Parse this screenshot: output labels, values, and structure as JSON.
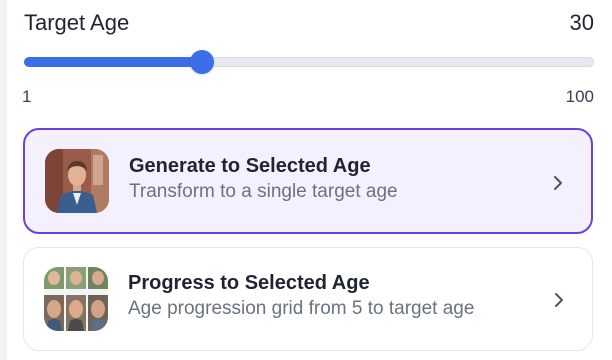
{
  "header": {
    "title": "Target Age",
    "value": "30"
  },
  "slider": {
    "min_label": "1",
    "max_label": "100",
    "min": 1,
    "max": 100,
    "value": 30,
    "color": "#3b6ee8"
  },
  "options": [
    {
      "title": "Generate to Selected Age",
      "subtitle": "Transform to a single target age",
      "selected": true,
      "icon": "portrait-thumbnail",
      "chevron": "chevron-right-icon"
    },
    {
      "title": "Progress to Selected Age",
      "subtitle": "Age progression grid from 5 to target age",
      "selected": false,
      "icon": "age-grid-thumbnail",
      "chevron": "chevron-right-icon"
    }
  ],
  "colors": {
    "accent": "#3b6ee8",
    "selected_border": "#6b3fe0",
    "selected_bg": "#f4f0fd"
  }
}
